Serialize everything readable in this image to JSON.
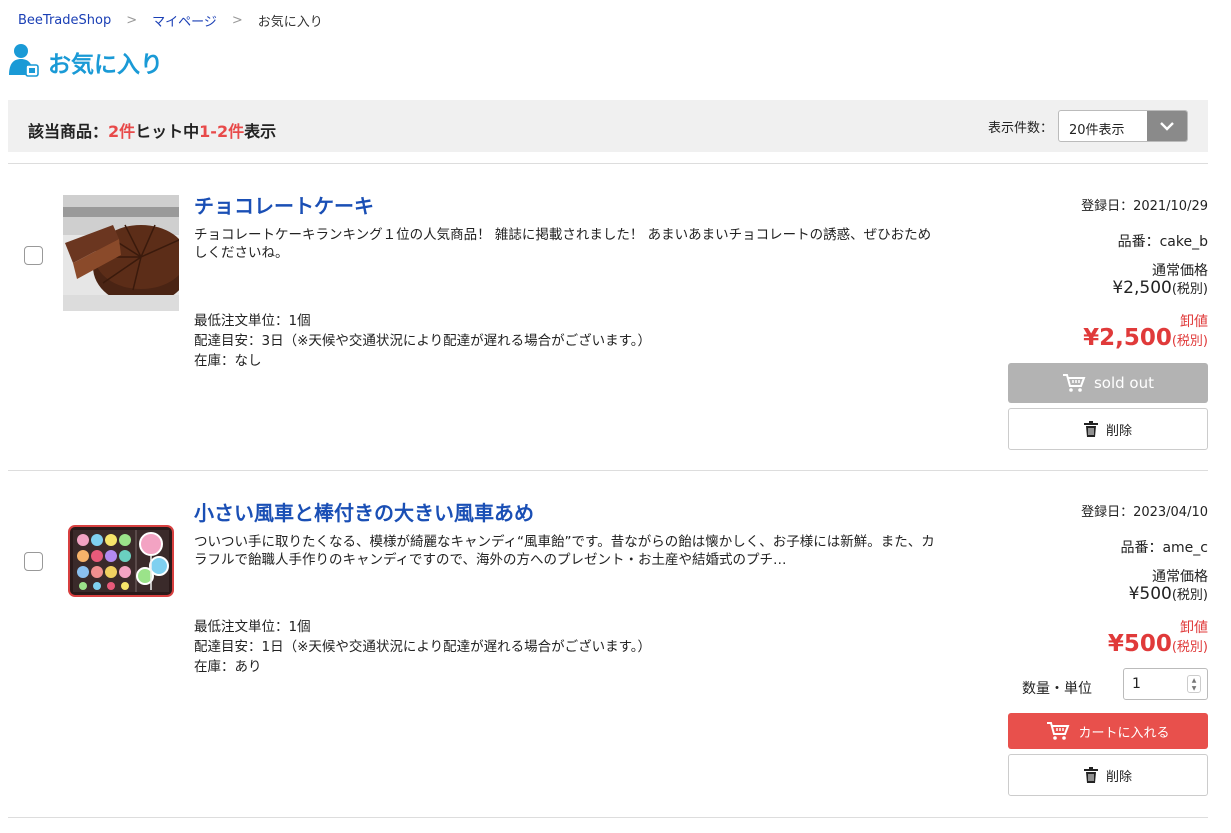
{
  "breadcrumb": {
    "home": "BeeTradeShop",
    "mypage": "マイページ",
    "current": "お気に入り"
  },
  "page": {
    "title": "お気に入り"
  },
  "results": {
    "prefix": "該当商品：",
    "hits": "2件",
    "mid": "ヒット中",
    "range": "1-2件",
    "suffix": "表示",
    "per_page_label": "表示件数：",
    "per_page_value": "20件表示"
  },
  "items": [
    {
      "name": "チョコレートケーキ",
      "description": "チョコレートケーキランキング１位の人気商品！ 雑誌に掲載されました！ あまいあまいチョコレートの誘惑、ぜひおためしくださいね。",
      "min_order": "最低注文単位：1個",
      "delivery": "配達目安：3日（※天候や交通状況により配達が遅れる場合がございます。）",
      "stock": "在庫：なし",
      "reg_date": "登録日：2021/10/29",
      "sku": "品番：cake_b",
      "regular_label": "通常価格",
      "regular_price": "¥2,500",
      "tax": "(税別)",
      "wholesale_label": "卸値",
      "wholesale_price": "¥2,500",
      "action_label": "sold out",
      "delete_label": "削除"
    },
    {
      "name": "小さい風車と棒付きの大きい風車あめ",
      "description": "ついつい手に取りたくなる、模様が綺麗なキャンディ“風車飴”です。昔ながらの飴は懐かしく、お子様には新鮮。また、カラフルで飴職人手作りのキャンディですので、海外の方へのプレゼント・お土産や結婚式のプチ…",
      "min_order": "最低注文単位：1個",
      "delivery": "配達目安：1日（※天候や交通状況により配達が遅れる場合がございます。）",
      "stock": "在庫：あり",
      "reg_date": "登録日：2023/04/10",
      "sku": "品番：ame_c",
      "regular_label": "通常価格",
      "regular_price": "¥500",
      "tax": "(税別)",
      "wholesale_label": "卸値",
      "wholesale_price": "¥500",
      "qty_label": "数量・単位",
      "qty_value": "1",
      "action_label": "カートに入れる",
      "delete_label": "削除"
    }
  ],
  "colors": {
    "accent_blue": "#1a9ad6",
    "link_blue": "#1a4fb5",
    "price_red": "#e03a3a",
    "cart_red": "#e8504c",
    "soldout_gray": "#b3b3b3"
  }
}
